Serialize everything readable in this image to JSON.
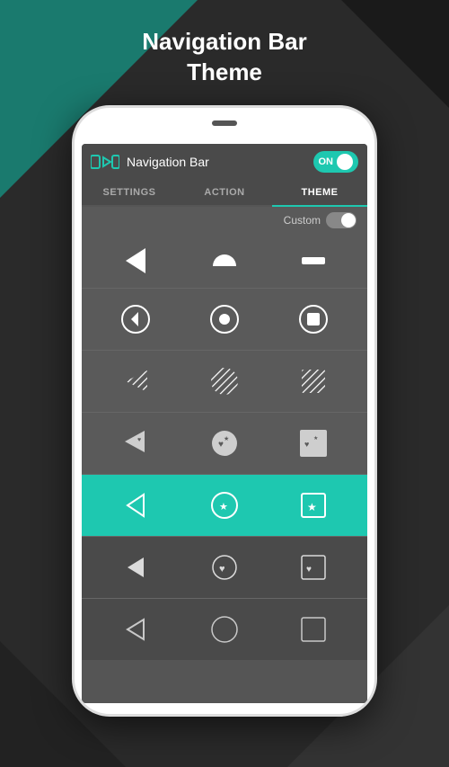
{
  "page": {
    "title_line1": "Navigation Bar",
    "title_line2": "Theme"
  },
  "header": {
    "title": "Navigation Bar",
    "toggle_label": "ON"
  },
  "tabs": [
    {
      "id": "settings",
      "label": "SETTINGS",
      "active": false
    },
    {
      "id": "action",
      "label": "ACTION",
      "active": false
    },
    {
      "id": "theme",
      "label": "THEME",
      "active": true
    }
  ],
  "custom_toggle": {
    "label": "Custom"
  },
  "rows": [
    {
      "id": "row-0",
      "selected": false,
      "type": "simple"
    },
    {
      "id": "row-1",
      "selected": false,
      "type": "outlined"
    },
    {
      "id": "row-2",
      "selected": false,
      "type": "diagonal"
    },
    {
      "id": "row-3",
      "selected": false,
      "type": "decorative"
    },
    {
      "id": "row-4",
      "selected": true,
      "type": "outlined-teal"
    },
    {
      "id": "row-5",
      "selected": false,
      "type": "bottom"
    },
    {
      "id": "row-6",
      "selected": false,
      "type": "bottom2"
    }
  ]
}
